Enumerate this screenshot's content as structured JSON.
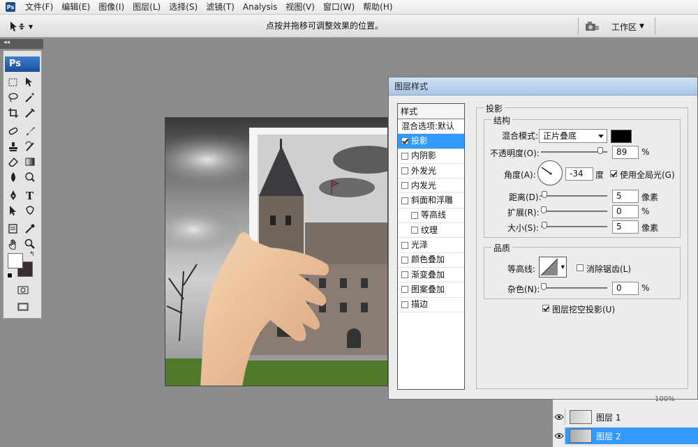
{
  "app": {
    "logo_text": "Ps",
    "mini_logo_text": "Ps"
  },
  "menubar": {
    "items": [
      "文件(F)",
      "编辑(E)",
      "图像(I)",
      "图层(L)",
      "选择(S)",
      "滤镜(T)",
      "Analysis",
      "视图(V)",
      "窗口(W)",
      "帮助(H)"
    ]
  },
  "options_bar": {
    "hint": "点按并拖移可调整效果的位置。",
    "workspace_label": "工作区"
  },
  "dialog": {
    "title": "图层样式",
    "styles_header": "样式",
    "styles": [
      {
        "label": "混合选项:默认",
        "checkbox": false,
        "checked": false,
        "indent": false,
        "selected": false
      },
      {
        "label": "投影",
        "checkbox": true,
        "checked": true,
        "indent": false,
        "selected": true
      },
      {
        "label": "内阴影",
        "checkbox": true,
        "checked": false,
        "indent": false,
        "selected": false
      },
      {
        "label": "外发光",
        "checkbox": true,
        "checked": false,
        "indent": false,
        "selected": false
      },
      {
        "label": "内发光",
        "checkbox": true,
        "checked": false,
        "indent": false,
        "selected": false
      },
      {
        "label": "斜面和浮雕",
        "checkbox": true,
        "checked": false,
        "indent": false,
        "selected": false
      },
      {
        "label": "等高线",
        "checkbox": true,
        "checked": false,
        "indent": true,
        "selected": false
      },
      {
        "label": "纹理",
        "checkbox": true,
        "checked": false,
        "indent": true,
        "selected": false
      },
      {
        "label": "光泽",
        "checkbox": true,
        "checked": false,
        "indent": false,
        "selected": false
      },
      {
        "label": "颜色叠加",
        "checkbox": true,
        "checked": false,
        "indent": false,
        "selected": false
      },
      {
        "label": "渐变叠加",
        "checkbox": true,
        "checked": false,
        "indent": false,
        "selected": false
      },
      {
        "label": "图案叠加",
        "checkbox": true,
        "checked": false,
        "indent": false,
        "selected": false
      },
      {
        "label": "描边",
        "checkbox": true,
        "checked": false,
        "indent": false,
        "selected": false
      }
    ],
    "section_title": "投影",
    "structure": {
      "title": "结构",
      "blend_mode_label": "混合模式:",
      "blend_mode_value": "正片叠底",
      "blend_color": "#000000",
      "opacity_label": "不透明度(O):",
      "opacity_value": "89",
      "opacity_level": 0.89,
      "opacity_unit": "%",
      "angle_label": "角度(A):",
      "angle_value": "-34",
      "angle_unit": "度",
      "global_light_label": "使用全局光(G)",
      "global_light_checked": true,
      "distance_label": "距离(D):",
      "distance_value": "5",
      "distance_unit": "像素",
      "spread_label": "扩展(R):",
      "spread_value": "0",
      "spread_unit": "%",
      "size_label": "大小(S):",
      "size_value": "5",
      "size_unit": "像素"
    },
    "quality": {
      "title": "品质",
      "contour_label": "等高线:",
      "antialias_label": "消除锯齿(L)",
      "antialias_checked": false,
      "noise_label": "杂色(N):",
      "noise_value": "0",
      "noise_unit": "%",
      "knockout_label": "图层挖空投影(U)",
      "knockout_checked": true
    }
  },
  "layers": {
    "zoom_text": "100%",
    "items": [
      {
        "name": "图层 1",
        "active": false
      },
      {
        "name": "图层 2",
        "active": true
      }
    ]
  },
  "colors": {
    "selection": "#3399ff",
    "title_bar": "#a9c6e8"
  }
}
